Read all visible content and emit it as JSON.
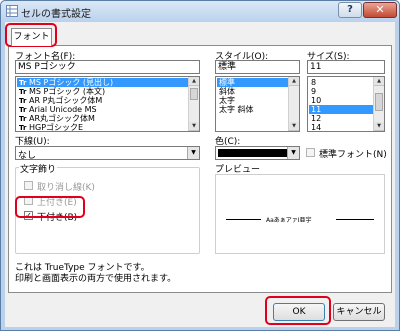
{
  "window": {
    "title": "セルの書式設定",
    "help_glyph": "?",
    "close_glyph": "✕"
  },
  "tabs": [
    {
      "label": "フォント"
    }
  ],
  "font": {
    "label": "フォント名(F):",
    "value": "MS Pゴシック",
    "items": [
      {
        "glyph": "Tr",
        "label": "MS Pゴシック (見出し)",
        "selected": true
      },
      {
        "glyph": "Tr",
        "label": "MS Pゴシック (本文)",
        "selected": false
      },
      {
        "glyph": "Tr",
        "label": "AR P丸ゴシック体M",
        "selected": false
      },
      {
        "glyph": "Tr",
        "label": "Arial Unicode MS",
        "selected": false
      },
      {
        "glyph": "Tr",
        "label": "AR丸ゴシック体M",
        "selected": false
      },
      {
        "glyph": "Tr",
        "label": "HGPゴシックE",
        "selected": false
      }
    ]
  },
  "style": {
    "label": "スタイル(O):",
    "value": "標準",
    "items": [
      {
        "label": "標準",
        "selected": true
      },
      {
        "label": "斜体",
        "selected": false
      },
      {
        "label": "太字",
        "selected": false
      },
      {
        "label": "太字 斜体",
        "selected": false
      }
    ]
  },
  "size": {
    "label": "サイズ(S):",
    "value": "11",
    "items": [
      {
        "label": "8",
        "selected": false
      },
      {
        "label": "9",
        "selected": false
      },
      {
        "label": "10",
        "selected": false
      },
      {
        "label": "11",
        "selected": true
      },
      {
        "label": "12",
        "selected": false
      },
      {
        "label": "14",
        "selected": false
      }
    ]
  },
  "underline": {
    "label": "下線(U):",
    "value": "なし"
  },
  "color": {
    "label": "色(C):",
    "swatch": "#000000"
  },
  "normal_font": {
    "label": "標準フォント(N)",
    "checked": false
  },
  "effects": {
    "label": "文字飾り",
    "strikethrough": {
      "label": "取り消し線(K)",
      "checked": false
    },
    "superscript": {
      "label": "上付き(E)",
      "checked": false
    },
    "subscript": {
      "label": "下付き(B)",
      "checked": true
    }
  },
  "preview": {
    "label": "プレビュー",
    "sample": "AaあぁアァⅠ亜宇"
  },
  "info": {
    "line1": "これは TrueType フォントです。",
    "line2": "印刷と画面表示の両方で使用されます。"
  },
  "buttons": {
    "ok": "OK",
    "cancel": "キャンセル"
  },
  "colors": {
    "highlight": "#e0001b",
    "selection": "#3399ff",
    "frame": "#b9d1ea"
  }
}
